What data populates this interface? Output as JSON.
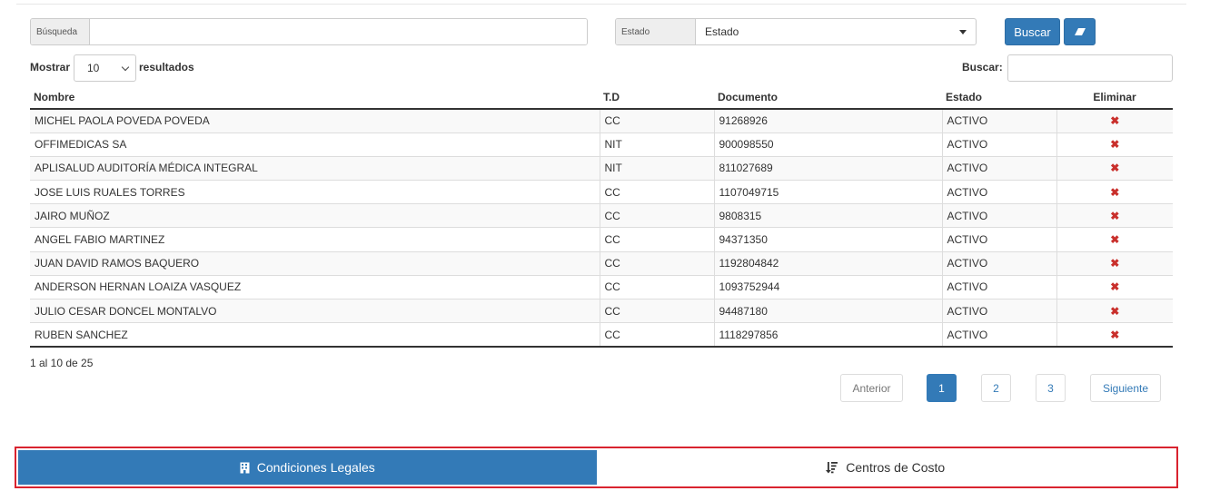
{
  "search": {
    "busqueda_label": "Búsqueda",
    "busqueda_value": "",
    "estado_label": "Estado",
    "estado_selected": "Estado",
    "buscar_button": "Buscar"
  },
  "length": {
    "mostrar": "Mostrar",
    "value": "10",
    "resultados": "resultados"
  },
  "filter": {
    "label": "Buscar:",
    "value": ""
  },
  "table": {
    "headers": [
      "Nombre",
      "T.D",
      "Documento",
      "Estado",
      "Eliminar"
    ],
    "rows": [
      {
        "nombre": "MICHEL PAOLA POVEDA POVEDA",
        "td": "CC",
        "documento": "91268926",
        "estado": "ACTIVO"
      },
      {
        "nombre": "OFFIMEDICAS SA",
        "td": "NIT",
        "documento": "900098550",
        "estado": "ACTIVO"
      },
      {
        "nombre": "APLISALUD AUDITORÍA MÉDICA INTEGRAL",
        "td": "NIT",
        "documento": "811027689",
        "estado": "ACTIVO"
      },
      {
        "nombre": "JOSE LUIS RUALES TORRES",
        "td": "CC",
        "documento": "1107049715",
        "estado": "ACTIVO"
      },
      {
        "nombre": "JAIRO MUÑOZ",
        "td": "CC",
        "documento": "9808315",
        "estado": "ACTIVO"
      },
      {
        "nombre": "ANGEL FABIO MARTINEZ",
        "td": "CC",
        "documento": "94371350",
        "estado": "ACTIVO"
      },
      {
        "nombre": "JUAN DAVID RAMOS BAQUERO",
        "td": "CC",
        "documento": "1192804842",
        "estado": "ACTIVO"
      },
      {
        "nombre": "ANDERSON HERNAN LOAIZA VASQUEZ",
        "td": "CC",
        "documento": "1093752944",
        "estado": "ACTIVO"
      },
      {
        "nombre": "JULIO CESAR DONCEL MONTALVO",
        "td": "CC",
        "documento": "94487180",
        "estado": "ACTIVO"
      },
      {
        "nombre": "RUBEN SANCHEZ",
        "td": "CC",
        "documento": "1118297856",
        "estado": "ACTIVO"
      }
    ],
    "delete_glyph": "✖"
  },
  "info": "1 al 10 de 25",
  "pagination": {
    "prev": "Anterior",
    "pages": [
      "1",
      "2",
      "3"
    ],
    "next": "Siguiente"
  },
  "tabs": {
    "legales": "Condiciones Legales",
    "costo": "Centros de Costo"
  },
  "colors": {
    "primary": "#337ab7",
    "danger": "#c9302c",
    "highlight_border": "#d9232f"
  },
  "icons": {
    "eraser": "eraser-icon",
    "building": "building-icon",
    "sort": "sort-amount-icon",
    "delete": "remove-icon"
  }
}
